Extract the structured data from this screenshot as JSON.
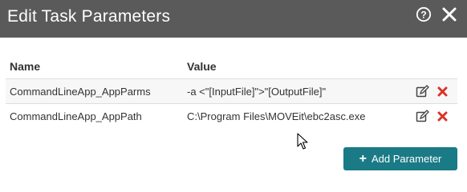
{
  "dialog": {
    "title": "Edit Task Parameters",
    "help_icon": "question-circle-icon",
    "close_icon": "close-icon"
  },
  "table": {
    "headers": {
      "name": "Name",
      "value": "Value"
    },
    "rows": [
      {
        "name": "CommandLineApp_AppParms",
        "value": "-a <\"[InputFile]\">\"[OutputFile]\""
      },
      {
        "name": "CommandLineApp_AppPath",
        "value": "C:\\Program Files\\MOVEit\\ebc2asc.exe"
      }
    ]
  },
  "actions": {
    "add_label": "Add Parameter",
    "add_icon": "plus-icon"
  },
  "colors": {
    "header_bg": "#5a5a5a",
    "accent": "#1a7a86",
    "delete": "#d9332b"
  }
}
